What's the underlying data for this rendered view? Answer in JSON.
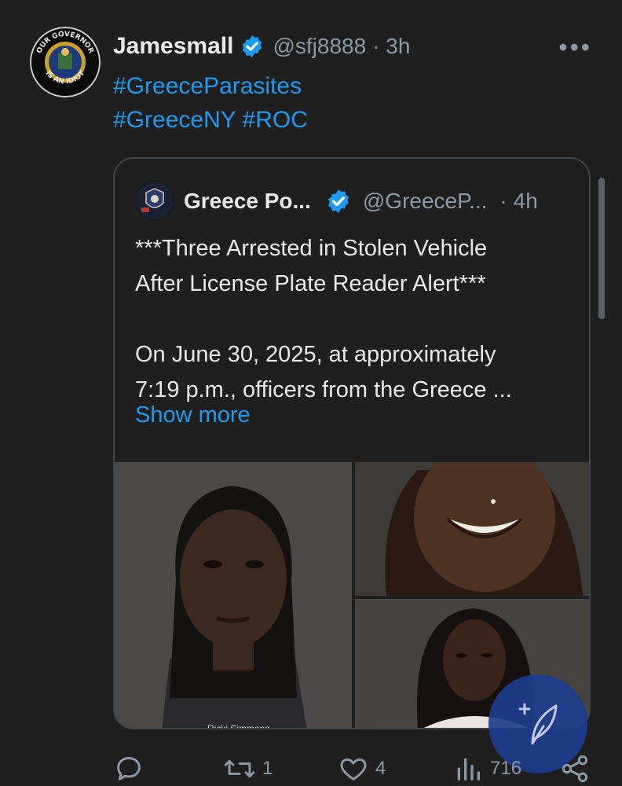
{
  "post": {
    "author_name": "Jamesmall",
    "author_handle": "@sfj8888",
    "time": "· 3h",
    "more_icon": "ellipsis-icon",
    "avatar_text": "OUR GOVERNOR IS AN IDIOT",
    "hashtags": [
      "#GreeceParasites",
      "#GreeceNY #ROC"
    ]
  },
  "quote": {
    "author_name": "Greece Po...",
    "author_handle": "@GreeceP...",
    "time": "· 4h",
    "lines": [
      "***Three Arrested in Stolen Vehicle",
      "After License Plate Reader Alert***",
      "",
      "On June 30, 2025, at approximately",
      "7:19 p.m., officers from the Greece ..."
    ],
    "show_more": "Show more",
    "photo_caption": "Ricki Simmons"
  },
  "actions": {
    "reply_count": "",
    "repost_count": "1",
    "like_count": "4",
    "views_count": "716"
  },
  "colors": {
    "background": "#1f1f1f",
    "link": "#1d9bf0",
    "muted": "#8b98a5",
    "verified": "#1d9bf0",
    "fab": "#1f3d8e"
  }
}
